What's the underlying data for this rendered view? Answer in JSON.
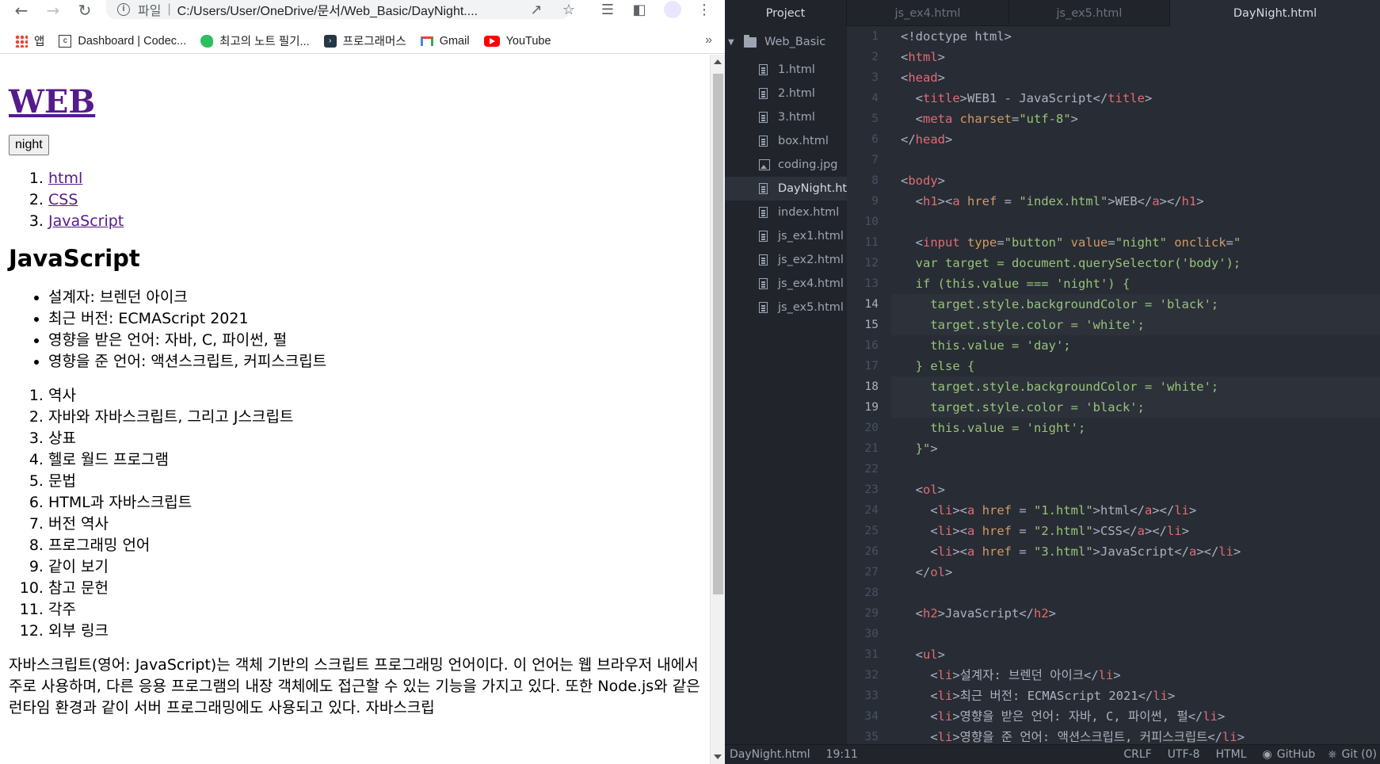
{
  "browser": {
    "address": {
      "scheme_label": "파일",
      "url": "C:/Users/User/OneDrive/문서/Web_Basic/DayNight...."
    },
    "bookmarks": [
      {
        "label": "앱",
        "icon": "apps-grid-icon"
      },
      {
        "label": "Dashboard | Codec...",
        "icon": "codecademy-icon"
      },
      {
        "label": "최고의 노트 필기...",
        "icon": "evernote-icon"
      },
      {
        "label": "프로그래머스",
        "icon": "programmers-icon"
      },
      {
        "label": "Gmail",
        "icon": "gmail-icon"
      },
      {
        "label": "YouTube",
        "icon": "youtube-icon"
      }
    ],
    "bookmarks_more": "»"
  },
  "page": {
    "title_link": "WEB",
    "night_button": "night",
    "links": [
      "html",
      "CSS",
      "JavaScript"
    ],
    "heading": "JavaScript",
    "facts": [
      "설계자: 브렌던 아이크",
      "최근 버전: ECMAScript 2021",
      "영향을 받은 언어: 자바, C, 파이썬, 펄",
      "영향을 준 언어: 액션스크립트, 커피스크립트"
    ],
    "toc": [
      "역사",
      "자바와 자바스크립트, 그리고 J스크립트",
      "상표",
      "헬로 월드 프로그램",
      "문법",
      "HTML과 자바스크립트",
      "버전 역사",
      "프로그래밍 언어",
      "같이 보기",
      "참고 문헌",
      "각주",
      "외부 링크"
    ],
    "paragraph": "자바스크립트(영어: JavaScript)는 객체 기반의 스크립트 프로그래밍 언어이다. 이 언어는 웹 브라우저 내에서 주로 사용하며, 다른 응용 프로그램의 내장 객체에도 접근할 수 있는 기능을 가지고 있다. 또한 Node.js와 같은 런타임 환경과 같이 서버 프로그래밍에도 사용되고 있다. 자바스크립"
  },
  "editor": {
    "project_tab": "Project",
    "tabs": [
      "js_ex4.html",
      "js_ex5.html",
      "DayNight.html"
    ],
    "active_tab": "DayNight.html",
    "tree_root": "Web_Basic",
    "files": [
      {
        "name": "1.html",
        "icon": "file-icon"
      },
      {
        "name": "2.html",
        "icon": "file-icon"
      },
      {
        "name": "3.html",
        "icon": "file-icon"
      },
      {
        "name": "box.html",
        "icon": "file-icon"
      },
      {
        "name": "coding.jpg",
        "icon": "image-icon"
      },
      {
        "name": "DayNight.htm",
        "icon": "file-icon"
      },
      {
        "name": "index.html",
        "icon": "file-icon"
      },
      {
        "name": "js_ex1.html",
        "icon": "file-icon"
      },
      {
        "name": "js_ex2.html",
        "icon": "file-icon"
      },
      {
        "name": "js_ex4.html",
        "icon": "file-icon"
      },
      {
        "name": "js_ex5.html",
        "icon": "file-icon"
      }
    ],
    "selected_file": "DayNight.htm",
    "current_lines": [
      14,
      15,
      18,
      19
    ],
    "code": [
      [
        [
          "p",
          "<!doctype html>"
        ]
      ],
      [
        [
          "p",
          "<"
        ],
        [
          "t",
          "html"
        ],
        [
          "p",
          ">"
        ]
      ],
      [
        [
          "p",
          "<"
        ],
        [
          "t",
          "head"
        ],
        [
          "p",
          ">"
        ]
      ],
      [
        [
          "p",
          "  <"
        ],
        [
          "t",
          "title"
        ],
        [
          "p",
          ">WEB1 - JavaScript</"
        ],
        [
          "t",
          "title"
        ],
        [
          "p",
          ">"
        ]
      ],
      [
        [
          "p",
          "  <"
        ],
        [
          "t",
          "meta "
        ],
        [
          "a",
          "charset"
        ],
        [
          "p",
          "="
        ],
        [
          "s",
          "\"utf-8\""
        ],
        [
          "p",
          ">"
        ]
      ],
      [
        [
          "p",
          "</"
        ],
        [
          "t",
          "head"
        ],
        [
          "p",
          ">"
        ]
      ],
      [
        [
          "p",
          ""
        ]
      ],
      [
        [
          "p",
          "<"
        ],
        [
          "t",
          "body"
        ],
        [
          "p",
          ">"
        ]
      ],
      [
        [
          "p",
          "  <"
        ],
        [
          "t",
          "h1"
        ],
        [
          "p",
          "><"
        ],
        [
          "t",
          "a "
        ],
        [
          "a",
          "href"
        ],
        [
          "p",
          " = "
        ],
        [
          "s",
          "\"index.html\""
        ],
        [
          "p",
          ">WEB</"
        ],
        [
          "t",
          "a"
        ],
        [
          "p",
          "></"
        ],
        [
          "t",
          "h1"
        ],
        [
          "p",
          ">"
        ]
      ],
      [
        [
          "p",
          ""
        ]
      ],
      [
        [
          "p",
          "  <"
        ],
        [
          "t",
          "input "
        ],
        [
          "a",
          "type"
        ],
        [
          "p",
          "="
        ],
        [
          "s",
          "\"button\" "
        ],
        [
          "a",
          "value"
        ],
        [
          "p",
          "="
        ],
        [
          "s",
          "\"night\" "
        ],
        [
          "a",
          "onclick"
        ],
        [
          "p",
          "="
        ],
        [
          "s",
          "\""
        ]
      ],
      [
        [
          "s",
          "  var target = document.querySelector('body');"
        ]
      ],
      [
        [
          "s",
          "  if (this.value === 'night') {"
        ]
      ],
      [
        [
          "s",
          "    target.style.backgroundColor = 'black';"
        ]
      ],
      [
        [
          "s",
          "    target.style.color = 'white';"
        ]
      ],
      [
        [
          "s",
          "    this.value = 'day';"
        ]
      ],
      [
        [
          "s",
          "  } else {"
        ]
      ],
      [
        [
          "s",
          "    target.style.backgroundColor = 'white';"
        ]
      ],
      [
        [
          "s",
          "    target.style.color = 'black';"
        ]
      ],
      [
        [
          "s",
          "    this.value = 'night';"
        ]
      ],
      [
        [
          "s",
          "  }\""
        ],
        [
          "p",
          ">"
        ]
      ],
      [
        [
          "p",
          ""
        ]
      ],
      [
        [
          "p",
          "  <"
        ],
        [
          "t",
          "ol"
        ],
        [
          "p",
          ">"
        ]
      ],
      [
        [
          "p",
          "    <"
        ],
        [
          "t",
          "li"
        ],
        [
          "p",
          "><"
        ],
        [
          "t",
          "a "
        ],
        [
          "a",
          "href"
        ],
        [
          "p",
          " = "
        ],
        [
          "s",
          "\"1.html\""
        ],
        [
          "p",
          ">html</"
        ],
        [
          "t",
          "a"
        ],
        [
          "p",
          "></"
        ],
        [
          "t",
          "li"
        ],
        [
          "p",
          ">"
        ]
      ],
      [
        [
          "p",
          "    <"
        ],
        [
          "t",
          "li"
        ],
        [
          "p",
          "><"
        ],
        [
          "t",
          "a "
        ],
        [
          "a",
          "href"
        ],
        [
          "p",
          " = "
        ],
        [
          "s",
          "\"2.html\""
        ],
        [
          "p",
          ">CSS</"
        ],
        [
          "t",
          "a"
        ],
        [
          "p",
          "></"
        ],
        [
          "t",
          "li"
        ],
        [
          "p",
          ">"
        ]
      ],
      [
        [
          "p",
          "    <"
        ],
        [
          "t",
          "li"
        ],
        [
          "p",
          "><"
        ],
        [
          "t",
          "a "
        ],
        [
          "a",
          "href"
        ],
        [
          "p",
          " = "
        ],
        [
          "s",
          "\"3.html\""
        ],
        [
          "p",
          ">JavaScript</"
        ],
        [
          "t",
          "a"
        ],
        [
          "p",
          "></"
        ],
        [
          "t",
          "li"
        ],
        [
          "p",
          ">"
        ]
      ],
      [
        [
          "p",
          "  </"
        ],
        [
          "t",
          "ol"
        ],
        [
          "p",
          ">"
        ]
      ],
      [
        [
          "p",
          ""
        ]
      ],
      [
        [
          "p",
          "  <"
        ],
        [
          "t",
          "h2"
        ],
        [
          "p",
          ">JavaScript</"
        ],
        [
          "t",
          "h2"
        ],
        [
          "p",
          ">"
        ]
      ],
      [
        [
          "p",
          ""
        ]
      ],
      [
        [
          "p",
          "  <"
        ],
        [
          "t",
          "ul"
        ],
        [
          "p",
          ">"
        ]
      ],
      [
        [
          "p",
          "    <"
        ],
        [
          "t",
          "li"
        ],
        [
          "p",
          ">설계자: 브렌던 아이크</"
        ],
        [
          "t",
          "li"
        ],
        [
          "p",
          ">"
        ]
      ],
      [
        [
          "p",
          "    <"
        ],
        [
          "t",
          "li"
        ],
        [
          "p",
          ">최근 버전: ECMAScript 2021</"
        ],
        [
          "t",
          "li"
        ],
        [
          "p",
          ">"
        ]
      ],
      [
        [
          "p",
          "    <"
        ],
        [
          "t",
          "li"
        ],
        [
          "p",
          ">영향을 받은 언어: 자바, C, 파이썬, 펄</"
        ],
        [
          "t",
          "li"
        ],
        [
          "p",
          ">"
        ]
      ],
      [
        [
          "p",
          "    <"
        ],
        [
          "t",
          "li"
        ],
        [
          "p",
          ">영향을 준 언어: 액션스크립트, 커피스크립트</"
        ],
        [
          "t",
          "li"
        ],
        [
          "p",
          ">"
        ]
      ]
    ],
    "status": {
      "file": "DayNight.html",
      "cursor": "19:11",
      "line_ending": "CRLF",
      "encoding": "UTF-8",
      "grammar": "HTML",
      "github": "GitHub",
      "git": "Git (0)"
    }
  },
  "colors": {
    "editor_bg": "#282c34",
    "tag": "#e06c75",
    "attribute": "#d19a66",
    "string": "#98c379",
    "visited_link": "#551a8b"
  }
}
